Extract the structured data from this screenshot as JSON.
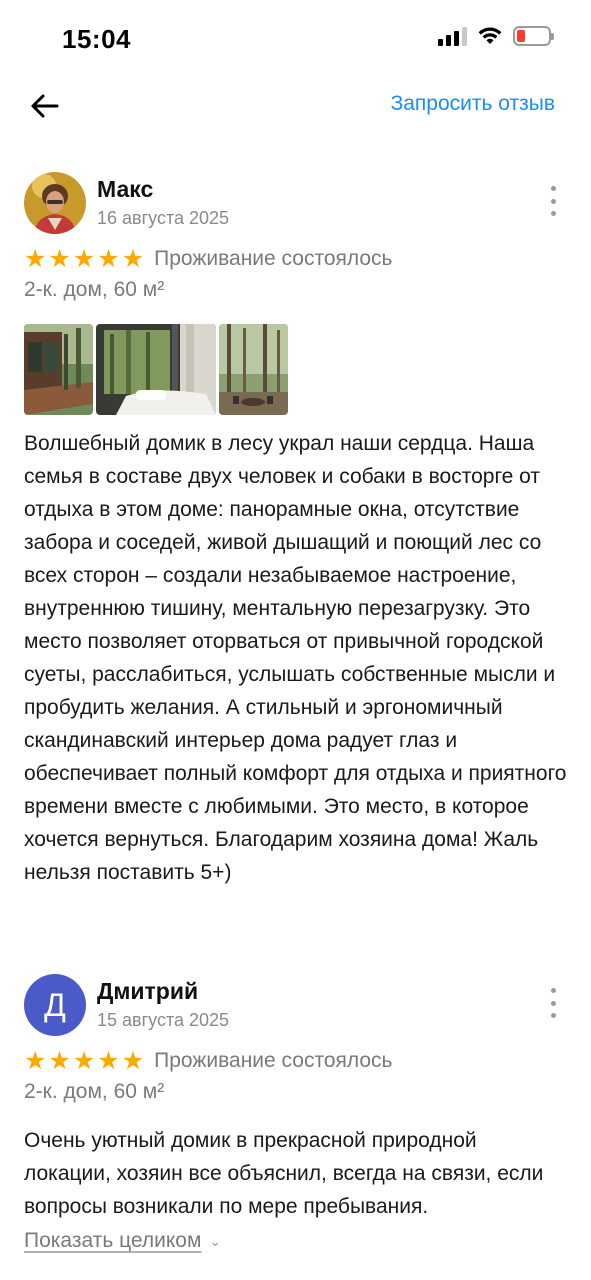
{
  "status_bar": {
    "time": "15:04"
  },
  "nav": {
    "request_review": "Запросить отзыв"
  },
  "reviews": [
    {
      "author": "Макс",
      "date": "16 августа 2025",
      "stars": 5,
      "stay_status": "Проживание состоялось",
      "property": "2-к. дом, 60 м²",
      "photo_count": 3,
      "text": "Волшебный домик в лесу украл наши сердца. Наша семья в составе двух человек и собаки в восторге от отдыха в этом доме: панорамные окна, отсутствие забора и соседей, живой дышащий и поющий лес со всех сторон – создали незабываемое настроение, внутреннюю тишину, ментальную перезагрузку. Это место позволяет оторваться от привычной городской суеты, расслабиться, услышать собственные мысли и пробудить желания. А стильный и эргономичный скандинавский интерьер дома радует глаз и обеспечивает полный комфорт для отдыха и приятного времени вместе с любимыми. Это место, в которое хочется вернуться. Благодарим хозяина дома! Жаль нельзя поставить 5+)"
    },
    {
      "author": "Дмитрий",
      "avatar_letter": "Д",
      "date": "15 августа 2025",
      "stars": 5,
      "stay_status": "Проживание состоялось",
      "property": "2-к. дом, 60 м²",
      "text": "Очень уютный домик в прекрасной природной локации, хозяин все объяснил, всегда на связи, если вопросы возникали по мере пребывания.",
      "show_more": "Показать целиком"
    }
  ],
  "colors": {
    "accent_link": "#1a8cff",
    "star": "#ffa800",
    "avatar_bg": "#4a5bc9"
  },
  "icons": [
    "back-arrow-icon",
    "more-vertical-icon",
    "star-icon",
    "chevron-down-icon",
    "signal-icon",
    "wifi-icon",
    "battery-icon"
  ]
}
